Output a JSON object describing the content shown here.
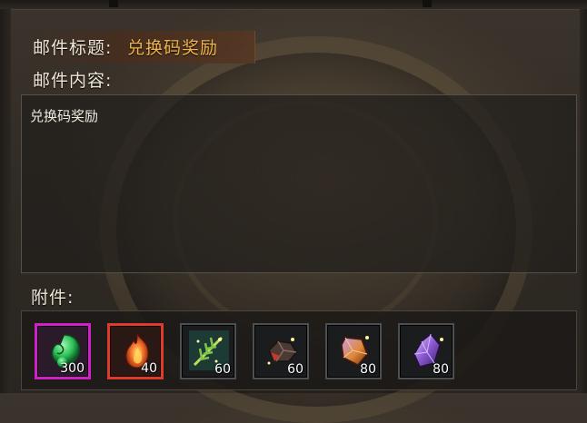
{
  "mail": {
    "title_label": "邮件标题:",
    "title_value": "兑换码奖励",
    "content_label": "邮件内容:",
    "content_text": "兑换码奖励",
    "attachments_label": "附件:"
  },
  "attachments": [
    {
      "icon": "green-jade-icon",
      "count": "300",
      "rarity": "purple",
      "color": "#2fc25a"
    },
    {
      "icon": "fire-flame-icon",
      "count": "40",
      "rarity": "red",
      "color": "#e2562a"
    },
    {
      "icon": "green-herb-icon",
      "count": "60",
      "rarity": "normal",
      "color": "#7fc44a"
    },
    {
      "icon": "dark-ore-icon",
      "count": "60",
      "rarity": "normal",
      "color": "#8a6a5a"
    },
    {
      "icon": "orange-crystal-icon",
      "count": "80",
      "rarity": "normal",
      "color": "#e08a3a"
    },
    {
      "icon": "purple-crystal-icon",
      "count": "80",
      "rarity": "normal",
      "color": "#8a5ad0"
    }
  ],
  "colors": {
    "title_value": "#f0b24a",
    "label": "#efe6d6",
    "purple_border": "#d21fc8",
    "red_border": "#e23a2a"
  }
}
